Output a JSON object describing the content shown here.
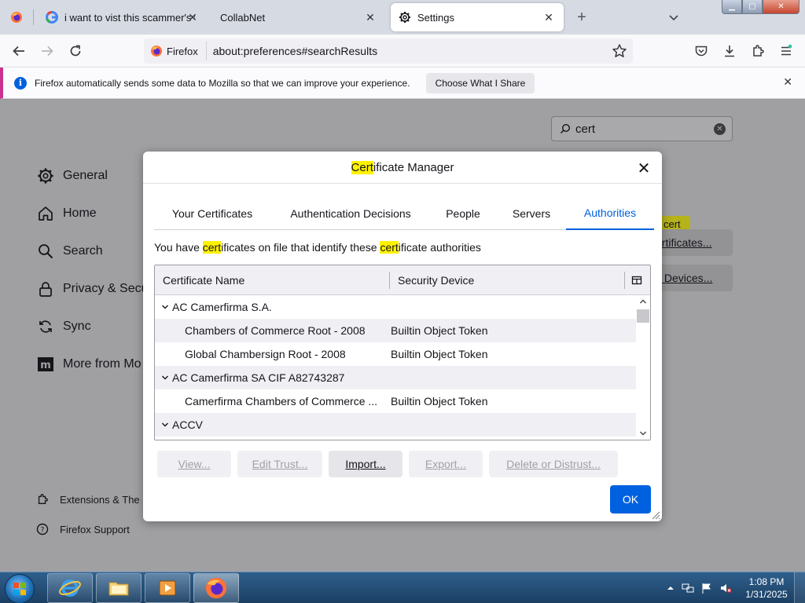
{
  "tabs": [
    {
      "label": ""
    },
    {
      "label": "i want to vist this scammer's we"
    },
    {
      "label": "CollabNet"
    },
    {
      "label": "Settings"
    }
  ],
  "navbar": {
    "identity_label": "Firefox",
    "url": "about:preferences#searchResults"
  },
  "notification": {
    "text": "Firefox automatically sends some data to Mozilla so that we can improve your experience.",
    "button": "Choose What I Share"
  },
  "settings": {
    "search_value": "cert",
    "categories": [
      "General",
      "Home",
      "Search",
      "Privacy & Secu",
      "Sync",
      "More from Mo"
    ],
    "footer": [
      "Extensions & The",
      "Firefox Support"
    ],
    "bg_highlight": "cert",
    "bg_buttons": [
      "ertificates...",
      "y Devices..."
    ]
  },
  "dialog": {
    "title_hl": "Cert",
    "title_rest": "ificate Manager",
    "tabs": [
      "Your Certificates",
      "Authentication Decisions",
      "People",
      "Servers",
      "Authorities"
    ],
    "selected_tab": "Authorities",
    "desc": {
      "p1": "You have ",
      "h1": "cert",
      "p2": "ificates on file that identify these ",
      "h2": "cert",
      "p3": "ificate authorities"
    },
    "columns": [
      "Certificate Name",
      "Security Device"
    ],
    "rows": [
      {
        "name": "AC Camerfirma S.A.",
        "device": ""
      },
      {
        "name": "Chambers of Commerce Root - 2008",
        "device": "Builtin Object Token"
      },
      {
        "name": "Global Chambersign Root - 2008",
        "device": "Builtin Object Token"
      },
      {
        "name": "AC Camerfirma SA CIF A82743287",
        "device": ""
      },
      {
        "name": "Camerfirma Chambers of Commerce ...",
        "device": "Builtin Object Token"
      },
      {
        "name": "ACCV",
        "device": ""
      }
    ],
    "actions": [
      "View...",
      "Edit Trust...",
      "Import...",
      "Export...",
      "Delete or Distrust..."
    ],
    "ok": "OK"
  },
  "taskbar": {
    "time": "1:08 PM",
    "date": "1/31/2025"
  },
  "colors": {
    "accent": "#0060df",
    "highlight": "#fff200",
    "ok_button": "#0061e0"
  }
}
